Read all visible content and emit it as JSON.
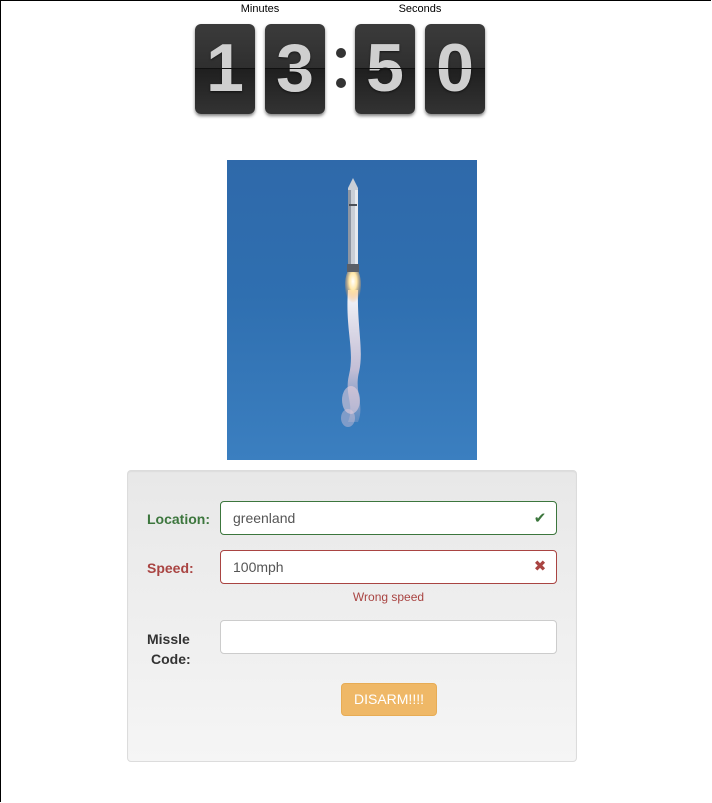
{
  "countdown": {
    "minutes_label": "Minutes",
    "seconds_label": "Seconds",
    "digits": [
      "1",
      "3",
      "5",
      "0"
    ]
  },
  "image": {
    "description": "rocket-launch-photo"
  },
  "form": {
    "location": {
      "label": "Location:",
      "value": "greenland",
      "state": "success"
    },
    "speed": {
      "label": "Speed:",
      "value": "100mph",
      "state": "error",
      "help": "Wrong speed"
    },
    "missile_code": {
      "label_line1": "Missle",
      "label_line2": "Code:",
      "value": ""
    },
    "submit_label": "DISARM!!!!"
  },
  "colors": {
    "success": "#3c763d",
    "error": "#a94442",
    "button": "#efb867",
    "sky": "#2f6fb0"
  }
}
